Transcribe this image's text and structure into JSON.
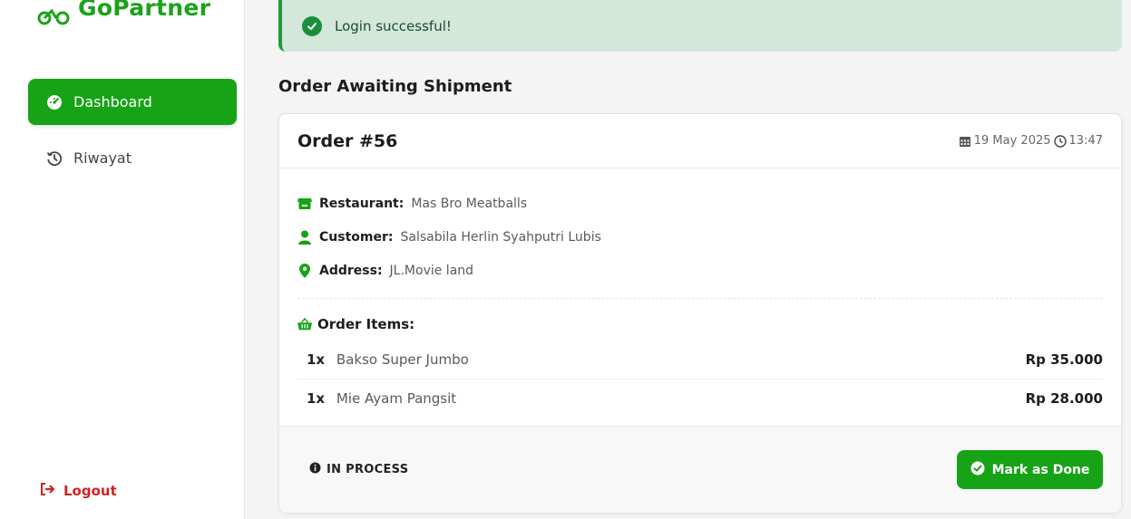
{
  "app": {
    "brand": "GoPartner",
    "accent": "#16a316"
  },
  "sidebar": {
    "items": [
      {
        "label": "Dashboard",
        "icon": "gauge-icon",
        "active": true
      },
      {
        "label": "Riwayat",
        "icon": "history-icon",
        "active": false
      }
    ],
    "logout_label": "Logout"
  },
  "alert": {
    "text": "Login successful!",
    "icon": "check-circle-icon"
  },
  "section": {
    "title": "Order Awaiting Shipment"
  },
  "order": {
    "title": "Order #56",
    "date": "19 May 2025",
    "time": "13:47",
    "restaurant_label": "Restaurant:",
    "restaurant": "Mas Bro Meatballs",
    "customer_label": "Customer:",
    "customer": "Salsabila Herlin Syahputri Lubis",
    "address_label": "Address:",
    "address": "JL.Movie land",
    "items_title": "Order Items:",
    "items": [
      {
        "qty": "1x",
        "name": "Bakso Super Jumbo",
        "price": "Rp 35.000"
      },
      {
        "qty": "1x",
        "name": "Mie Ayam Pangsit",
        "price": "Rp 28.000"
      }
    ],
    "status": "IN PROCESS",
    "action_label": "Mark as Done"
  }
}
